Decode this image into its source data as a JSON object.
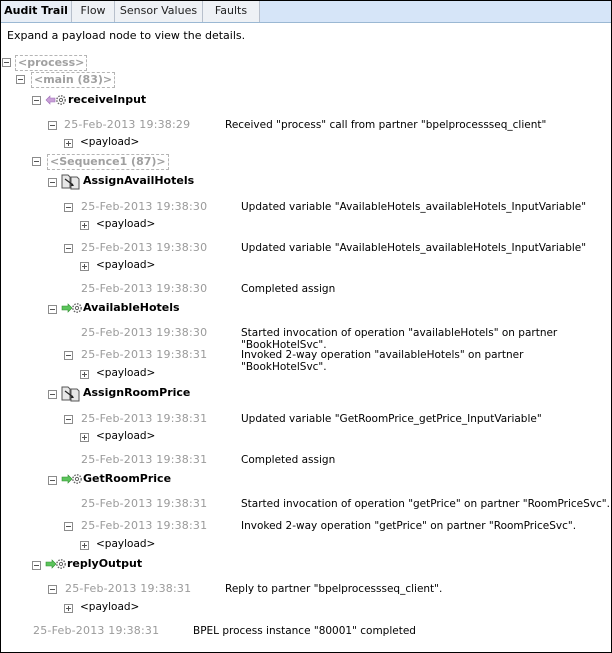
{
  "tabs": [
    {
      "label": "Audit Trail",
      "active": true
    },
    {
      "label": "Flow",
      "active": false
    },
    {
      "label": "Sensor Values",
      "active": false
    },
    {
      "label": "Faults",
      "active": false
    }
  ],
  "colors": {
    "tab_bar": "#d6e5f8",
    "timestamp": "#9a9a9a",
    "scope_label": "#a0a0a0",
    "receive_arrow": "#c9a0d8",
    "invoke_arrow": "#5cc45c"
  },
  "hint": "Expand a payload node to view the details.",
  "tree": {
    "process": "<process>",
    "main": "<main (83)>",
    "sequence": "<Sequence1 (87)>",
    "payload_label": "<payload>",
    "activities": {
      "receiveInput": {
        "name": "receiveInput",
        "icon": "receive-icon",
        "events": [
          {
            "time": "25-Feb-2013 19:38:29",
            "message": "Received \"process\" call from partner \"bpelprocessseq_client\"",
            "has_payload": true
          }
        ]
      },
      "assignAvailHotels": {
        "name": "AssignAvailHotels",
        "icon": "assign-icon",
        "events": [
          {
            "time": "25-Feb-2013 19:38:30",
            "message": "Updated variable \"AvailableHotels_availableHotels_InputVariable\"",
            "has_payload": true
          },
          {
            "time": "25-Feb-2013 19:38:30",
            "message": "Updated variable \"AvailableHotels_availableHotels_InputVariable\"",
            "has_payload": true
          },
          {
            "time": "25-Feb-2013 19:38:30",
            "message": "Completed assign",
            "has_payload": false
          }
        ]
      },
      "availableHotels": {
        "name": "AvailableHotels",
        "icon": "invoke-icon",
        "events": [
          {
            "time": "25-Feb-2013 19:38:30",
            "message": "Started invocation of operation \"availableHotels\" on partner \"BookHotelSvc\".",
            "has_payload": false
          },
          {
            "time": "25-Feb-2013 19:38:31",
            "message": "Invoked 2-way operation \"availableHotels\" on partner \"BookHotelSvc\".",
            "has_payload": true
          }
        ]
      },
      "assignRoomPrice": {
        "name": "AssignRoomPrice",
        "icon": "assign-icon",
        "events": [
          {
            "time": "25-Feb-2013 19:38:31",
            "message": "Updated variable \"GetRoomPrice_getPrice_InputVariable\"",
            "has_payload": true
          },
          {
            "time": "25-Feb-2013 19:38:31",
            "message": "Completed assign",
            "has_payload": false
          }
        ]
      },
      "getRoomPrice": {
        "name": "GetRoomPrice",
        "icon": "invoke-icon",
        "events": [
          {
            "time": "25-Feb-2013 19:38:31",
            "message": "Started invocation of operation \"getPrice\" on partner \"RoomPriceSvc\".",
            "has_payload": false
          },
          {
            "time": "25-Feb-2013 19:38:31",
            "message": "Invoked 2-way operation \"getPrice\" on partner \"RoomPriceSvc\".",
            "has_payload": true
          }
        ]
      },
      "replyOutput": {
        "name": "replyOutput",
        "icon": "reply-icon",
        "events": [
          {
            "time": "25-Feb-2013 19:38:31",
            "message": "Reply to partner \"bpelprocessseq_client\".",
            "has_payload": true
          }
        ]
      }
    },
    "final_event": {
      "time": "25-Feb-2013 19:38:31",
      "message": "BPEL process instance \"80001\" completed"
    }
  }
}
